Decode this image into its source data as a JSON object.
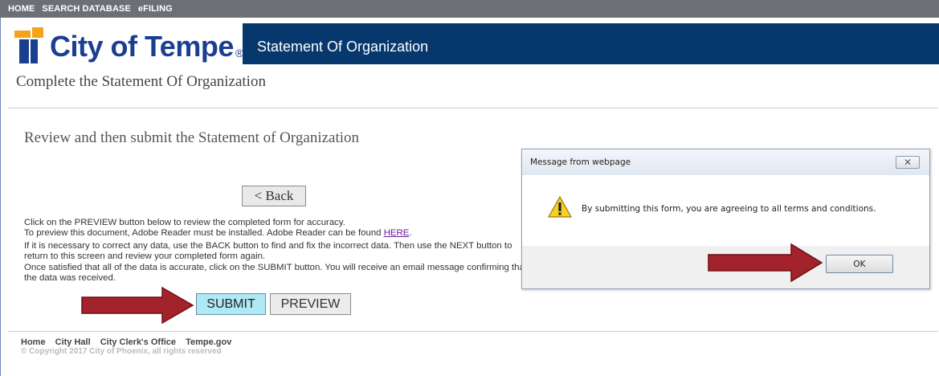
{
  "nav": {
    "items": [
      "HOME",
      "SEARCH DATABASE",
      "eFILING"
    ]
  },
  "header": {
    "logo_text": "City of Tempe",
    "logo_reg": "®",
    "title": "Statement Of Organization"
  },
  "page": {
    "subtitle": "Complete the Statement Of Organization",
    "heading": "Review and then submit the Statement of Organization",
    "back_label": "< Back",
    "para1_line1": "Click on the PREVIEW button below to review the completed form for accuracy.",
    "para1_line2_prefix": "To preview this document, Adobe Reader must be installed. Adobe Reader can be found ",
    "para1_link": "HERE",
    "para1_line2_suffix": ".",
    "para2": "If it is necessary to correct any data, use the BACK button to find and fix the incorrect data. Then use the NEXT button to return to this screen and review your completed form again.",
    "para3": "Once satisfied that all of the data is accurate, click on the SUBMIT button. You will receive an email message confirming that the data was received.",
    "submit_label": "SUBMIT",
    "preview_label": "PREVIEW"
  },
  "footer": {
    "links": [
      "Home",
      "City Hall",
      "City Clerk's Office",
      "Tempe.gov"
    ],
    "copyright": "© Copyright 2017 City of Phoenix, all rights reserved"
  },
  "dialog": {
    "title": "Message from webpage",
    "message": "By submitting this form, you are agreeing to all terms and conditions.",
    "ok_label": "OK",
    "close_symbol": "✕"
  },
  "colors": {
    "header_bar": "#07386d",
    "logo_orange": "#f5a31a",
    "logo_blue": "#1b3f8f",
    "submit_bg": "#aee9f5",
    "arrow_red": "#a2232b"
  },
  "icons": [
    "warning-icon",
    "close-icon",
    "red-arrow"
  ]
}
